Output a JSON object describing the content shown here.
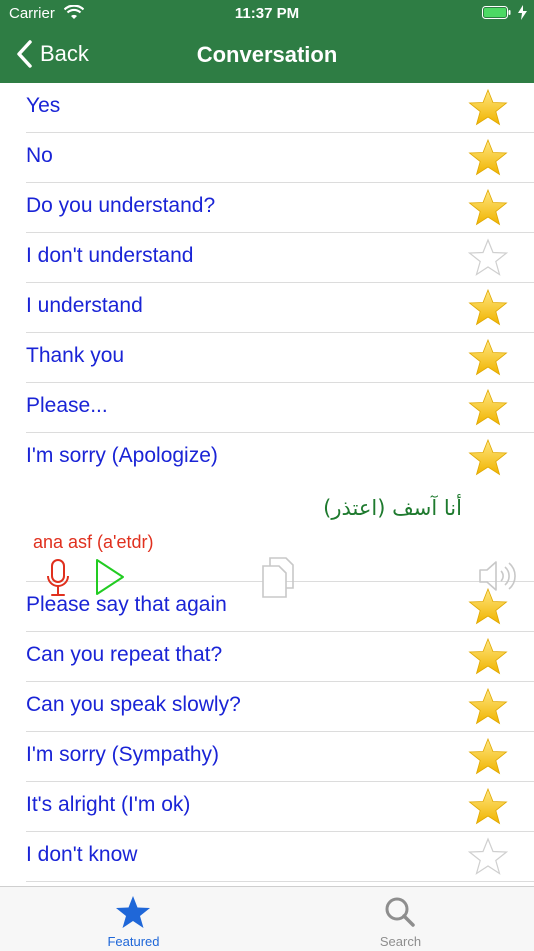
{
  "status": {
    "carrier": "Carrier",
    "time": "11:37 PM"
  },
  "nav": {
    "back_label": "Back",
    "title": "Conversation"
  },
  "phrases": [
    {
      "label": "Yes",
      "favorite": true
    },
    {
      "label": "No",
      "favorite": true
    },
    {
      "label": "Do you understand?",
      "favorite": true
    },
    {
      "label": "I don't understand",
      "favorite": false
    },
    {
      "label": "I understand",
      "favorite": true
    },
    {
      "label": "Thank you",
      "favorite": true
    },
    {
      "label": "Please...",
      "favorite": true
    },
    {
      "label": "I'm sorry (Apologize)",
      "favorite": true,
      "expanded": true,
      "arabic": "أنا آسف (اعتذر)",
      "transliteration": "ana asf (a'etdr)"
    },
    {
      "label": "Please say that again",
      "favorite": true
    },
    {
      "label": "Can you repeat that?",
      "favorite": true
    },
    {
      "label": "Can you speak slowly?",
      "favorite": true
    },
    {
      "label": "I'm sorry (Sympathy)",
      "favorite": true
    },
    {
      "label": "It's alright (I'm ok)",
      "favorite": true
    },
    {
      "label": "I don't know",
      "favorite": false
    }
  ],
  "icons": {
    "star_filled": "star-filled-icon",
    "star_empty": "star-outline-icon",
    "mic": "microphone-icon",
    "play": "play-icon",
    "copy": "copy-icon",
    "speaker": "speaker-icon"
  },
  "colors": {
    "header": "#2e7d44",
    "phrase_text": "#1a24d6",
    "arabic_text": "#1e7a2e",
    "transliteration_text": "#e0301e",
    "tab_active": "#1f67d8",
    "star": "#f4c430"
  },
  "tabs": [
    {
      "label": "Featured",
      "active": true
    },
    {
      "label": "Search",
      "active": false
    }
  ]
}
